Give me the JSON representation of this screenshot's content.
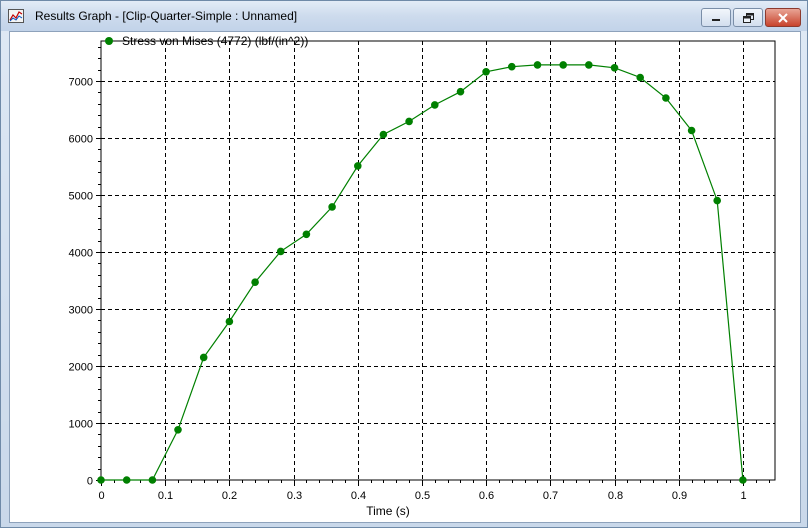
{
  "window": {
    "title": "Results Graph - [Clip-Quarter-Simple : Unnamed]",
    "app_icon": "chart-graph-icon",
    "buttons": {
      "minimize_icon": "minimize-icon",
      "maximize_icon": "restore-icon",
      "close_icon": "close-icon"
    }
  },
  "colors": {
    "series": "#008000",
    "grid": "#000000",
    "background": "#ffffff"
  },
  "chart_data": {
    "type": "line",
    "title": "",
    "xlabel": "Time (s)",
    "ylabel": "",
    "xlim": [
      0,
      1.05
    ],
    "ylim": [
      0,
      7700
    ],
    "grid": true,
    "grid_style": "dashed",
    "legend_position": "top-left",
    "x_ticks": [
      0,
      0.1,
      0.2,
      0.3,
      0.4,
      0.5,
      0.6,
      0.7,
      0.8,
      0.9,
      1
    ],
    "x_tick_labels": [
      "0",
      "0.1",
      "0.2",
      "0.3",
      "0.4",
      "0.5",
      "0.6",
      "0.7",
      "0.8",
      "0.9",
      "1"
    ],
    "y_ticks": [
      0,
      1000,
      2000,
      3000,
      4000,
      5000,
      6000,
      7000
    ],
    "y_tick_labels": [
      "0",
      "1000",
      "2000",
      "3000",
      "4000",
      "5000",
      "6000",
      "7000"
    ],
    "series": [
      {
        "name": "Stress von Mises (4772) (lbf/(in^2))",
        "color": "#008000",
        "marker": "circle",
        "x": [
          0,
          0.04,
          0.08,
          0.12,
          0.16,
          0.2,
          0.24,
          0.28,
          0.32,
          0.36,
          0.4,
          0.44,
          0.48,
          0.52,
          0.56,
          0.6,
          0.64,
          0.68,
          0.72,
          0.76,
          0.8,
          0.84,
          0.88,
          0.92,
          0.96,
          1.0
        ],
        "y": [
          0,
          0,
          0,
          880,
          2150,
          2780,
          3470,
          4010,
          4310,
          4790,
          5510,
          6060,
          6290,
          6580,
          6810,
          7160,
          7250,
          7280,
          7280,
          7280,
          7230,
          7060,
          6700,
          6130,
          4900,
          0
        ]
      }
    ]
  }
}
